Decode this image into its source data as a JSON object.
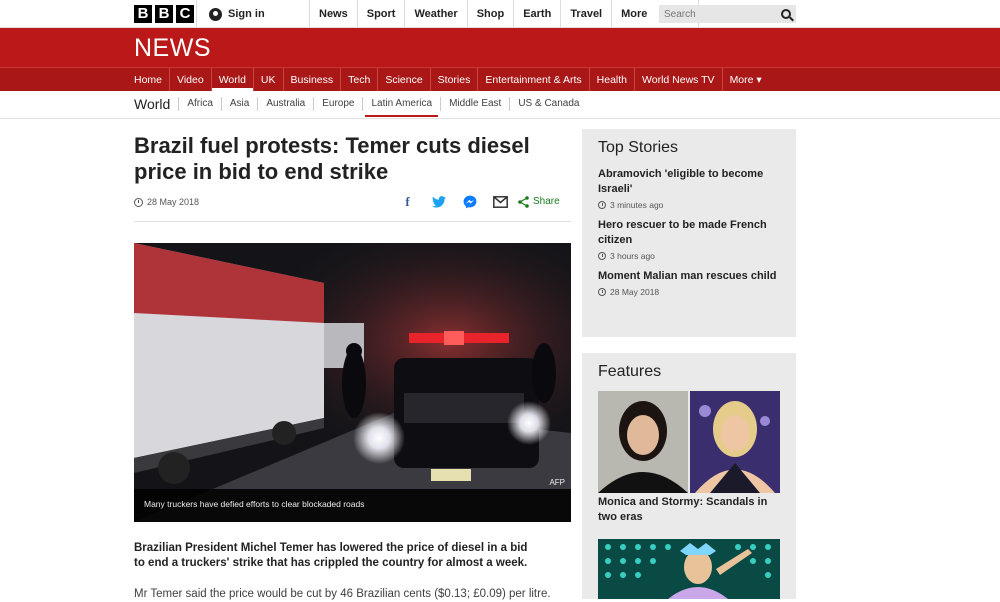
{
  "bbc_logo": [
    "B",
    "B",
    "C"
  ],
  "signin": "Sign in",
  "topnav": [
    "News",
    "Sport",
    "Weather",
    "Shop",
    "Earth",
    "Travel"
  ],
  "topnav_more": "More",
  "search_placeholder": "Search",
  "masthead_logo": "NEWS",
  "mainnav": [
    "Home",
    "Video",
    "World",
    "UK",
    "Business",
    "Tech",
    "Science",
    "Stories",
    "Entertainment & Arts",
    "Health",
    "World News TV",
    "More ▾"
  ],
  "mainnav_active": "World",
  "section": "World",
  "subnav": [
    "Africa",
    "Asia",
    "Australia",
    "Europe",
    "Latin America",
    "Middle East",
    "US & Canada"
  ],
  "subnav_active": "Latin America",
  "article": {
    "headline": "Brazil fuel protests: Temer cuts diesel price in bid to end strike",
    "date": "28 May 2018",
    "share_label": "Share",
    "photo_credit": "AFP",
    "photo_caption": "Many truckers have defied efforts to clear blockaded roads",
    "lead": "Brazilian President Michel Temer has lowered the price of diesel in a bid to end a truckers' strike that has crippled the country for almost a week.",
    "body": "Mr Temer said the price would be cut by 46 Brazilian cents ($0.13; £0.09) per litre."
  },
  "top_stories": {
    "heading": "Top Stories",
    "items": [
      {
        "title": "Abramovich 'eligible to become Israeli'",
        "time": "3 minutes ago"
      },
      {
        "title": "Hero rescuer to be made French citizen",
        "time": "3 hours ago"
      },
      {
        "title": "Moment Malian man rescues child",
        "time": "28 May 2018"
      }
    ]
  },
  "features": {
    "heading": "Features",
    "item_title": "Monica and Stormy: Scandals in two eras"
  },
  "colors": {
    "brand_red": "#bb1919",
    "nav_red": "#a91717",
    "share_green": "#1a7a1a"
  }
}
